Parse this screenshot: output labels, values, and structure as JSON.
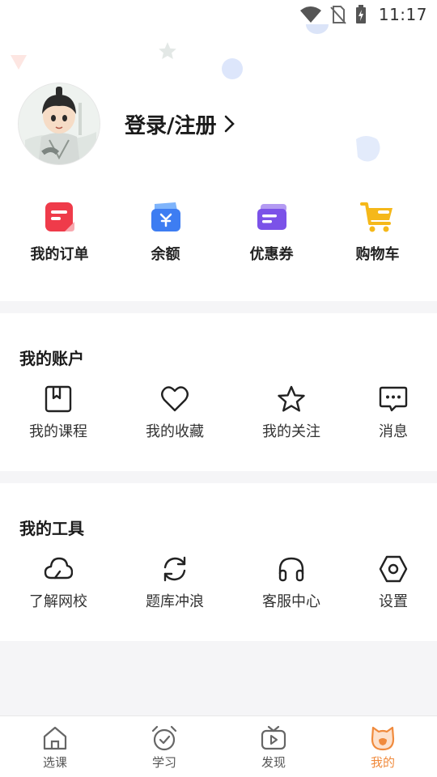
{
  "status_bar": {
    "time": "11:17"
  },
  "profile": {
    "login_label": "登录/注册"
  },
  "quick_actions": [
    {
      "label": "我的订单",
      "icon": "order-icon",
      "color": "#ef3b4a"
    },
    {
      "label": "余额",
      "icon": "wallet-icon",
      "color": "#3d7df2"
    },
    {
      "label": "优惠券",
      "icon": "coupon-icon",
      "color": "#7b52e8"
    },
    {
      "label": "购物车",
      "icon": "cart-icon",
      "color": "#f5b81a"
    }
  ],
  "account": {
    "title": "我的账户",
    "items": [
      {
        "label": "我的课程",
        "icon": "bookmark-book-icon"
      },
      {
        "label": "我的收藏",
        "icon": "heart-icon"
      },
      {
        "label": "我的关注",
        "icon": "star-icon"
      },
      {
        "label": "消息",
        "icon": "message-icon"
      }
    ]
  },
  "tools": {
    "title": "我的工具",
    "items": [
      {
        "label": "了解网校",
        "icon": "cloud-icon"
      },
      {
        "label": "题库冲浪",
        "icon": "refresh-icon"
      },
      {
        "label": "客服中心",
        "icon": "headset-icon"
      },
      {
        "label": "设置",
        "icon": "hexagon-settings-icon"
      }
    ]
  },
  "tabbar": {
    "active_color": "#f08a3c",
    "items": [
      {
        "label": "选课",
        "icon": "home-icon"
      },
      {
        "label": "学习",
        "icon": "alarm-clock-icon"
      },
      {
        "label": "发现",
        "icon": "tv-icon"
      },
      {
        "label": "我的",
        "icon": "cat-face-icon"
      }
    ]
  }
}
